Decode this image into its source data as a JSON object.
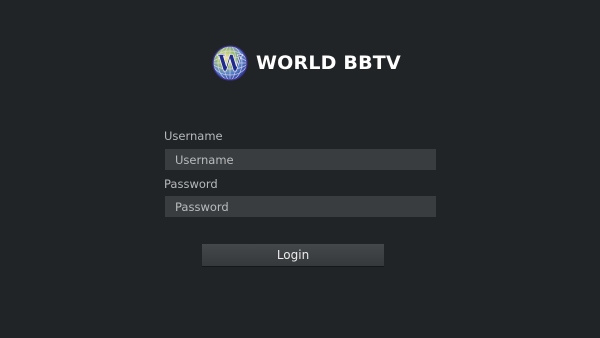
{
  "logo": {
    "icon": "globe-w-logo",
    "letter": "W",
    "text": "WORLD BBTV"
  },
  "form": {
    "username": {
      "label": "Username",
      "placeholder": "Username",
      "value": ""
    },
    "password": {
      "label": "Password",
      "placeholder": "Password",
      "value": ""
    },
    "login_label": "Login"
  },
  "colors": {
    "background": "#212427",
    "input_background": "#3a3d40",
    "button_background": "#3f4245",
    "label_text": "#b6b8ba",
    "logo_text": "#ffffff"
  }
}
